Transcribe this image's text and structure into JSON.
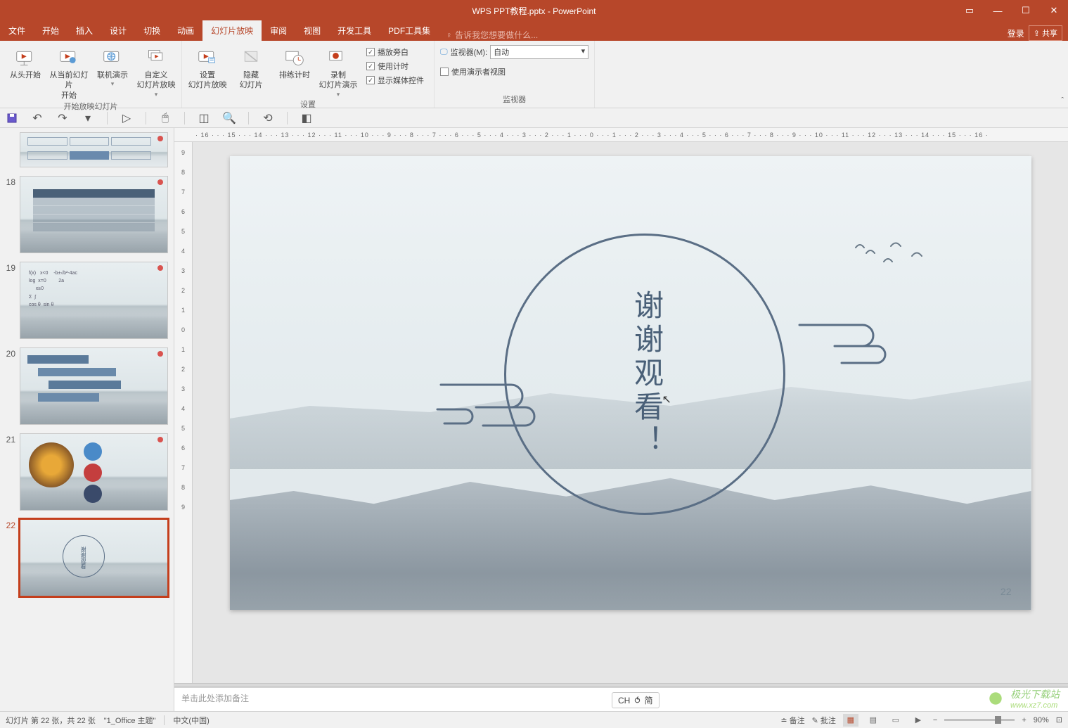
{
  "titlebar": {
    "title": "WPS PPT教程.pptx - PowerPoint",
    "login": "登录",
    "share": "共享"
  },
  "menutabs": {
    "file": "文件",
    "home": "开始",
    "insert": "插入",
    "design": "设计",
    "transition": "切换",
    "animation": "动画",
    "slideshow": "幻灯片放映",
    "review": "审阅",
    "view": "视图",
    "devtools": "开发工具",
    "pdf": "PDF工具集",
    "tellme": "告诉我您想要做什么..."
  },
  "ribbon": {
    "from_begin": "从头开始",
    "from_current": "从当前幻灯片\n开始",
    "online_present": "联机演示",
    "custom_show": "自定义\n幻灯片放映",
    "group_start": "开始放映幻灯片",
    "setup_show": "设置\n幻灯片放映",
    "hide_slide": "隐藏\n幻灯片",
    "rehearse": "排练计时",
    "record": "录制\n幻灯片演示",
    "chk_narration": "播放旁白",
    "chk_timings": "使用计时",
    "chk_media": "显示媒体控件",
    "group_setup": "设置",
    "monitor_label": "监视器(M):",
    "monitor_value": "自动",
    "presenter_view": "使用演示者视图",
    "group_monitor": "监视器"
  },
  "thumbnails": [
    {
      "num": "",
      "type": "diagram"
    },
    {
      "num": "18",
      "type": "table"
    },
    {
      "num": "19",
      "type": "formula"
    },
    {
      "num": "20",
      "type": "steps"
    },
    {
      "num": "21",
      "type": "images"
    },
    {
      "num": "22",
      "type": "thanks",
      "active": true
    }
  ],
  "slide": {
    "text": "谢谢观看！",
    "number": "22"
  },
  "notes": {
    "placeholder": "单击此处添加备注"
  },
  "statusbar": {
    "slide_info": "幻灯片 第 22 张，共 22 张",
    "theme": "\"1_Office 主题\"",
    "language": "中文(中国)",
    "notes_btn": "备注",
    "comments_btn": "批注",
    "zoom_value": "90%"
  },
  "ime": {
    "lang": "CH",
    "mode": "简"
  },
  "watermark": {
    "name": "极光下载站",
    "url": "www.xz7.com"
  },
  "ruler_h": "· 16 · · · 15 · · · 14 · · · 13 · · · 12 · · · 11 · · · 10 · · · 9 · · · 8 · · · 7 · · · 6 · · · 5 · · · 4 · · · 3 · · · 2 · · · 1 · · · 0 · · · 1 · · · 2 · · · 3 · · · 4 · · · 5 · · · 6 · · · 7 · · · 8 · · · 9 · · · 10 · · · 11 · · · 12 · · · 13 · · · 14 · · · 15 · · · 16 ·",
  "ruler_v": [
    "9",
    "8",
    "7",
    "6",
    "5",
    "4",
    "3",
    "2",
    "1",
    "0",
    "1",
    "2",
    "3",
    "4",
    "5",
    "6",
    "7",
    "8",
    "9"
  ]
}
